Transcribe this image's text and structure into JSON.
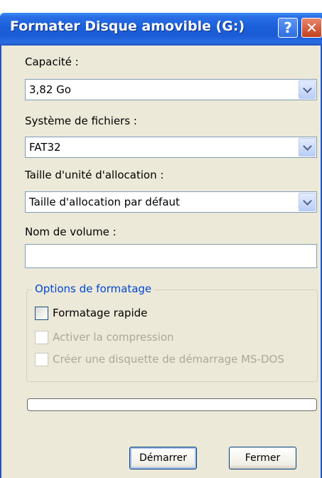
{
  "window": {
    "title": "Formater Disque amovible (G:)",
    "help_glyph": "?",
    "close_glyph": "✕"
  },
  "capacity": {
    "label": "Capacité :",
    "value": "3,82 Go"
  },
  "filesystem": {
    "label": "Système de fichiers :",
    "value": "FAT32"
  },
  "allocation": {
    "label": "Taille d'unité d'allocation :",
    "value": "Taille d'allocation par défaut"
  },
  "volume": {
    "label": "Nom de volume :",
    "value": ""
  },
  "options": {
    "legend": "Options de formatage",
    "quick_format": {
      "label": "Formatage rapide",
      "checked": false,
      "enabled": true
    },
    "compression": {
      "label": "Activer la compression",
      "checked": false,
      "enabled": false
    },
    "msdos_boot": {
      "label": "Créer une disquette de démarrage MS-DOS",
      "checked": false,
      "enabled": false
    }
  },
  "progress": {
    "value": 0
  },
  "buttons": {
    "start": "Démarrer",
    "close": "Fermer"
  },
  "colors": {
    "title_bar": "#1c5bd6",
    "dialog_bg": "#ece9d8",
    "group_legend": "#0046d5",
    "disabled_text": "#aca899"
  }
}
